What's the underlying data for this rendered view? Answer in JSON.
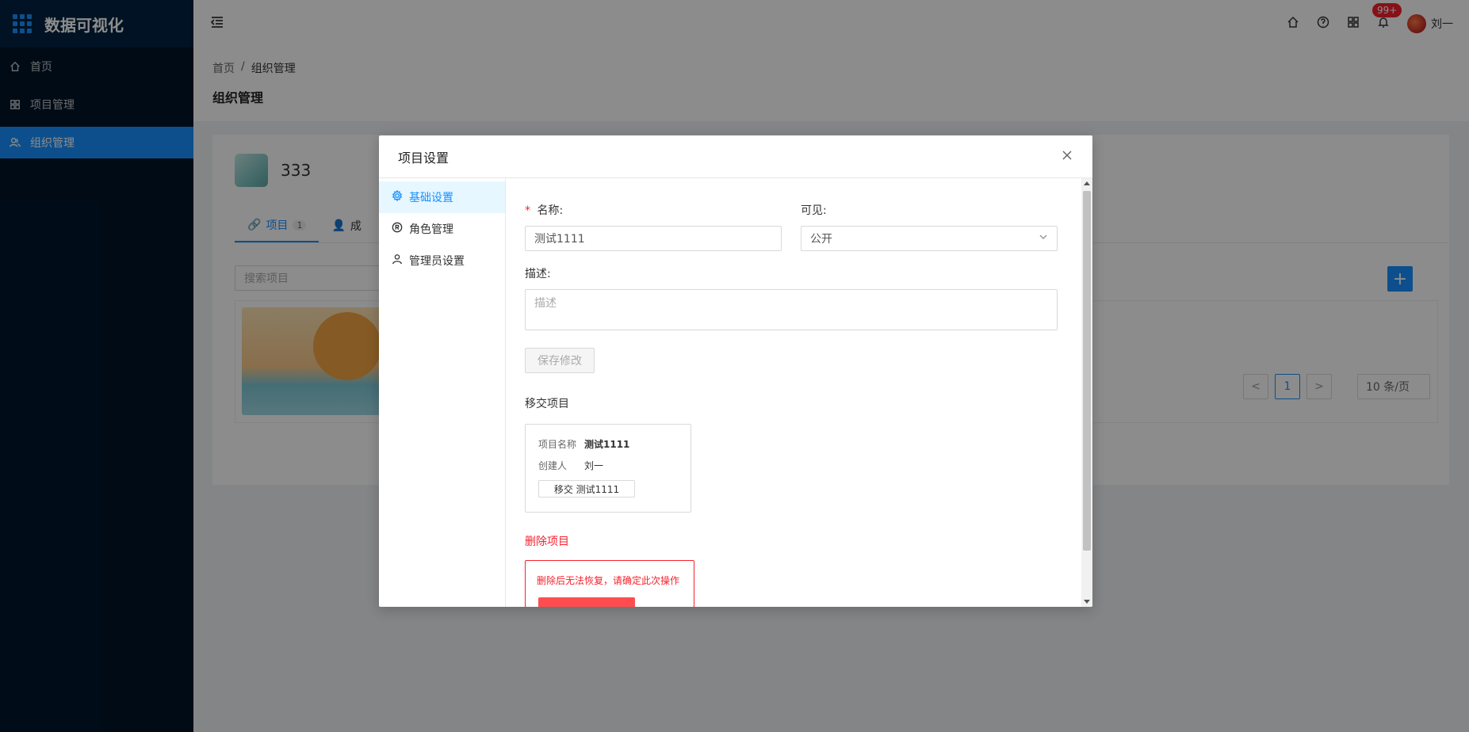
{
  "app": {
    "title": "数据可视化"
  },
  "sidebar": {
    "items": [
      {
        "label": "首页",
        "icon": "home-icon"
      },
      {
        "label": "项目管理",
        "icon": "grid-icon"
      },
      {
        "label": "组织管理",
        "icon": "team-icon",
        "active": true
      }
    ]
  },
  "header": {
    "notification_badge": "99+",
    "user_name": "刘一"
  },
  "page": {
    "breadcrumb": [
      "首页",
      "/",
      "组织管理"
    ],
    "title": "组织管理"
  },
  "org": {
    "name": "333",
    "tabs": [
      {
        "label": "项目",
        "count": "1",
        "active": true
      },
      {
        "label": "成"
      }
    ],
    "search_placeholder": "搜索项目",
    "add_label": "+"
  },
  "pagination": {
    "prev": "<",
    "current": "1",
    "next": ">",
    "page_size": "10 条/页"
  },
  "modal": {
    "title": "项目设置",
    "nav": [
      {
        "label": "基础设置",
        "active": true
      },
      {
        "label": "角色管理"
      },
      {
        "label": "管理员设置"
      }
    ],
    "form": {
      "name_required": "*",
      "name_label": "名称:",
      "name_value": "测试1111",
      "visible_label": "可见:",
      "visible_value": "公开",
      "desc_label": "描述:",
      "desc_placeholder": "描述",
      "save_label": "保存修改"
    },
    "transfer": {
      "section_title": "移交项目",
      "project_name_key": "项目名称",
      "project_name_value": "测试1111",
      "creator_key": "创建人",
      "creator_value": "刘一",
      "button_label": "移交 测试1111"
    },
    "delete": {
      "section_title": "删除项目",
      "warning": "删除后无法恢复，请确定此次操作"
    }
  },
  "colors": {
    "primary": "#1890ff",
    "sidebar_bg": "#001529",
    "danger": "#f5222d"
  }
}
